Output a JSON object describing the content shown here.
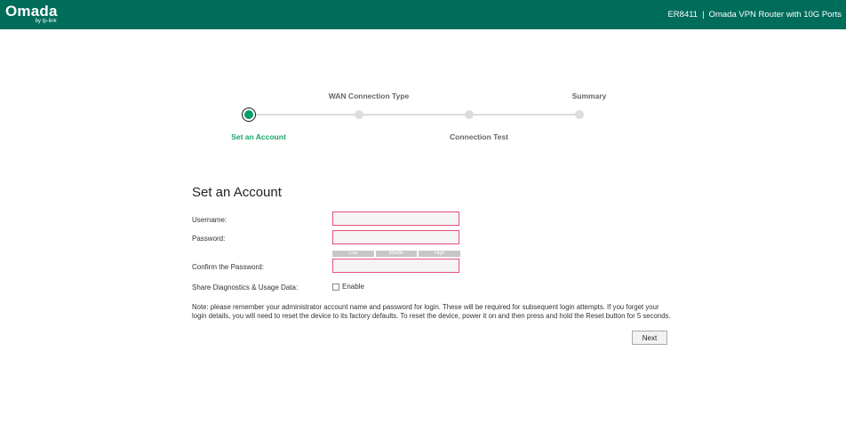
{
  "header": {
    "logo_text": "Omada",
    "logo_subtext": "by tp-link",
    "model": "ER8411",
    "separator": "|",
    "product": "Omada VPN Router with 10G Ports"
  },
  "steps": [
    {
      "label": "Set an Account",
      "state": "current"
    },
    {
      "label": "WAN Connection Type",
      "state": "pending"
    },
    {
      "label": "Connection Test",
      "state": "pending"
    },
    {
      "label": "Summary",
      "state": "pending"
    }
  ],
  "form": {
    "title": "Set an Account",
    "username_label": "Username:",
    "username_value": "",
    "password_label": "Password:",
    "password_value": "",
    "strength": [
      "Low",
      "Middle",
      "High"
    ],
    "confirm_label": "Confirm the Password:",
    "confirm_value": "",
    "diagnostics_label": "Share Diagnostics & Usage Data:",
    "enable_label": "Enable",
    "enable_checked": false,
    "note": "Note: please remember your administrator account name and password for login. These will be required for subsequent login attempts. If you forget your login details, you will need to reset the device to its factory defaults. To reset the device, power it on and then press and hold the Reset button for 5 seconds.",
    "next_label": "Next"
  },
  "colors": {
    "header_bg": "#006d5b",
    "active_step": "#19a46b",
    "input_error_border": "#e8507a"
  }
}
